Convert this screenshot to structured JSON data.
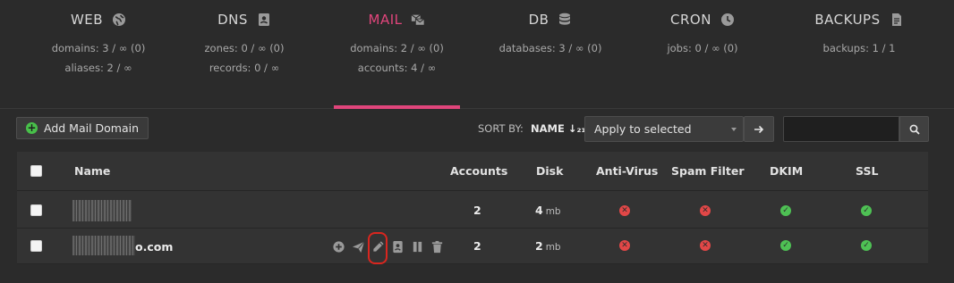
{
  "tabs": [
    {
      "title": "WEB",
      "icon": "globe-icon",
      "lines": [
        "domains: 3 / ∞ (0)",
        "aliases: 2 / ∞"
      ],
      "active": false
    },
    {
      "title": "DNS",
      "icon": "address-book-icon",
      "lines": [
        "zones: 0 / ∞ (0)",
        "records: 0 / ∞"
      ],
      "active": false
    },
    {
      "title": "MAIL",
      "icon": "mail-stack-icon",
      "lines": [
        "domains: 2 / ∞ (0)",
        "accounts: 4 / ∞"
      ],
      "active": true
    },
    {
      "title": "DB",
      "icon": "database-icon",
      "lines": [
        "databases: 3 / ∞ (0)"
      ],
      "active": false
    },
    {
      "title": "CRON",
      "icon": "clock-icon",
      "lines": [
        "jobs: 0 / ∞ (0)"
      ],
      "active": false
    },
    {
      "title": "BACKUPS",
      "icon": "file-icon",
      "lines": [
        "backups: 1 / 1"
      ],
      "active": false
    }
  ],
  "toolbar": {
    "add_label": "Add Mail Domain",
    "sort_by_label": "SORT BY:",
    "sort_value": "NAME ↓₂₁",
    "bulk_select": "Apply to selected",
    "apply_icon": "arrow-right-icon",
    "search_placeholder": ""
  },
  "table": {
    "columns": [
      "Name",
      "Accounts",
      "Disk",
      "Anti-Virus",
      "Spam Filter",
      "DKIM",
      "SSL"
    ],
    "rows": [
      {
        "name": "",
        "accounts": "2",
        "disk_value": "4",
        "disk_unit": "mb",
        "antivirus": "off",
        "spam": "off",
        "dkim": "on",
        "ssl": "on"
      },
      {
        "name": "o.com",
        "accounts": "2",
        "disk_value": "2",
        "disk_unit": "mb",
        "antivirus": "off",
        "spam": "off",
        "dkim": "on",
        "ssl": "on"
      }
    ],
    "row_actions": [
      "add-icon",
      "send-icon",
      "edit-icon",
      "address-book-icon",
      "pause-icon",
      "trash-icon"
    ]
  },
  "colors": {
    "accent": "#e0457b",
    "ok": "#4ec154",
    "error": "#e24747",
    "highlight": "#d9261f"
  }
}
